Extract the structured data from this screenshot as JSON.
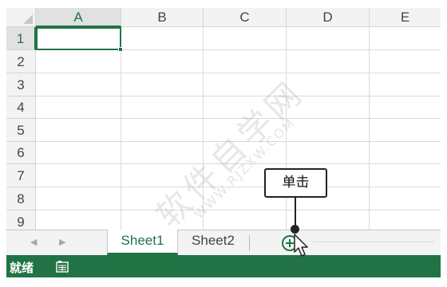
{
  "grid": {
    "columns": [
      "A",
      "B",
      "C",
      "D",
      "E"
    ],
    "active_column": "A",
    "rows": [
      "1",
      "2",
      "3",
      "4",
      "5",
      "6",
      "7",
      "8",
      "9"
    ],
    "active_row": "1",
    "active_cell": "A1"
  },
  "sheet_bar": {
    "nav_prev_icon": "triangle-left-icon",
    "nav_next_icon": "triangle-right-icon",
    "tabs": [
      {
        "label": "Sheet1",
        "active": true
      },
      {
        "label": "Sheet2",
        "active": false
      }
    ],
    "add_sheet_icon": "plus-circle-icon"
  },
  "status_bar": {
    "status": "就绪",
    "macro_icon": "macro-record-icon"
  },
  "callout": {
    "text": "单击"
  },
  "watermark": {
    "main": "软件自学网",
    "sub": "WWW.RJZXW.COM"
  },
  "colors": {
    "accent": "#217346",
    "header_bg": "#f3f3f3",
    "gridline": "#dadada",
    "status_bar_bg": "#217346"
  }
}
